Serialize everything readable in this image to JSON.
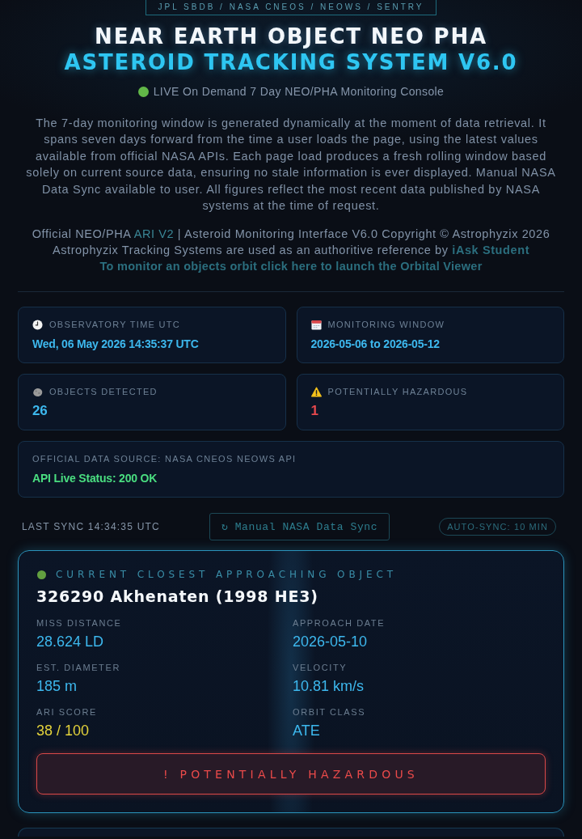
{
  "source_badge": {
    "text": "JPL SBDB / NASA CNEOS / NEOWS / SENTRY"
  },
  "header": {
    "title": "NEAR EARTH OBJECT NEO PHA",
    "subtitle": "ASTEROID TRACKING SYSTEM V6.0",
    "live_line": "LIVE On Demand 7 Day NEO/PHA Monitoring Console"
  },
  "description": "The 7-day monitoring window is generated dynamically at the moment of data retrieval. It spans seven days forward from the time a user loads the page, using the latest values available from official NASA APIs. Each page load produces a fresh rolling window based solely on current source data, ensuring no stale information is ever displayed. Manual NASA Data Sync available to user. All figures reflect the most recent data published by NASA systems at the time of request.",
  "credits": [
    {
      "parts": [
        {
          "kind": "text",
          "text": "Official NEO/PHA "
        },
        {
          "kind": "link",
          "text": "ARI V2"
        },
        {
          "kind": "text",
          "text": " | Asteroid Monitoring Interface V6.0 Copyright © Astrophyzix 2026"
        }
      ]
    },
    {
      "parts": [
        {
          "kind": "text",
          "text": "Astrophyzix Tracking Systems are used as an authoritive reference by "
        },
        {
          "kind": "strong_link",
          "text": "iAsk Student"
        }
      ]
    }
  ],
  "orbital_viewer_link": "To monitor an objects orbit click here to launch the Orbital Viewer",
  "stats": [
    {
      "kind": "time",
      "label": "OBSERVATORY TIME UTC",
      "value": "Wed, 06 May 2026 14:35:37 UTC"
    },
    {
      "kind": "window",
      "label": "MONITORING WINDOW",
      "value": "2026-05-06 to 2026-05-12"
    },
    {
      "kind": "count",
      "label": "OBJECTS DETECTED",
      "value": "26"
    },
    {
      "kind": "hazard",
      "label": "POTENTIALLY HAZARDOUS",
      "value": "1"
    }
  ],
  "data_source": {
    "label": "OFFICIAL DATA SOURCE: NASA CNEOS NEOWS API",
    "status": "API Live Status: 200 OK",
    "ok": true
  },
  "sync_bar": {
    "last_sync": "LAST SYNC 14:34:35 UTC",
    "button": "↻ Manual NASA Data Sync",
    "auto_sync": "AUTO-SYNC: 10 MIN"
  },
  "closest": {
    "heading": "CURRENT CLOSEST APPROACHING OBJECT",
    "name": "326290 Akhenaten (1998 HE3)",
    "fields": [
      {
        "kind": "metric",
        "label": "MISS DISTANCE",
        "value": "28.624 LD"
      },
      {
        "kind": "metric",
        "label": "APPROACH DATE",
        "value": "2026-05-10"
      },
      {
        "kind": "metric",
        "label": "EST. DIAMETER",
        "value": "185 m"
      },
      {
        "kind": "metric",
        "label": "VELOCITY",
        "value": "10.81 km/s"
      },
      {
        "kind": "score",
        "label": "ARI SCORE",
        "value": "38 / 100"
      },
      {
        "kind": "metric",
        "label": "ORBIT CLASS",
        "value": "ATE"
      }
    ],
    "hazard": {
      "hazardous": true,
      "text": "! POTENTIALLY HAZARDOUS"
    }
  }
}
